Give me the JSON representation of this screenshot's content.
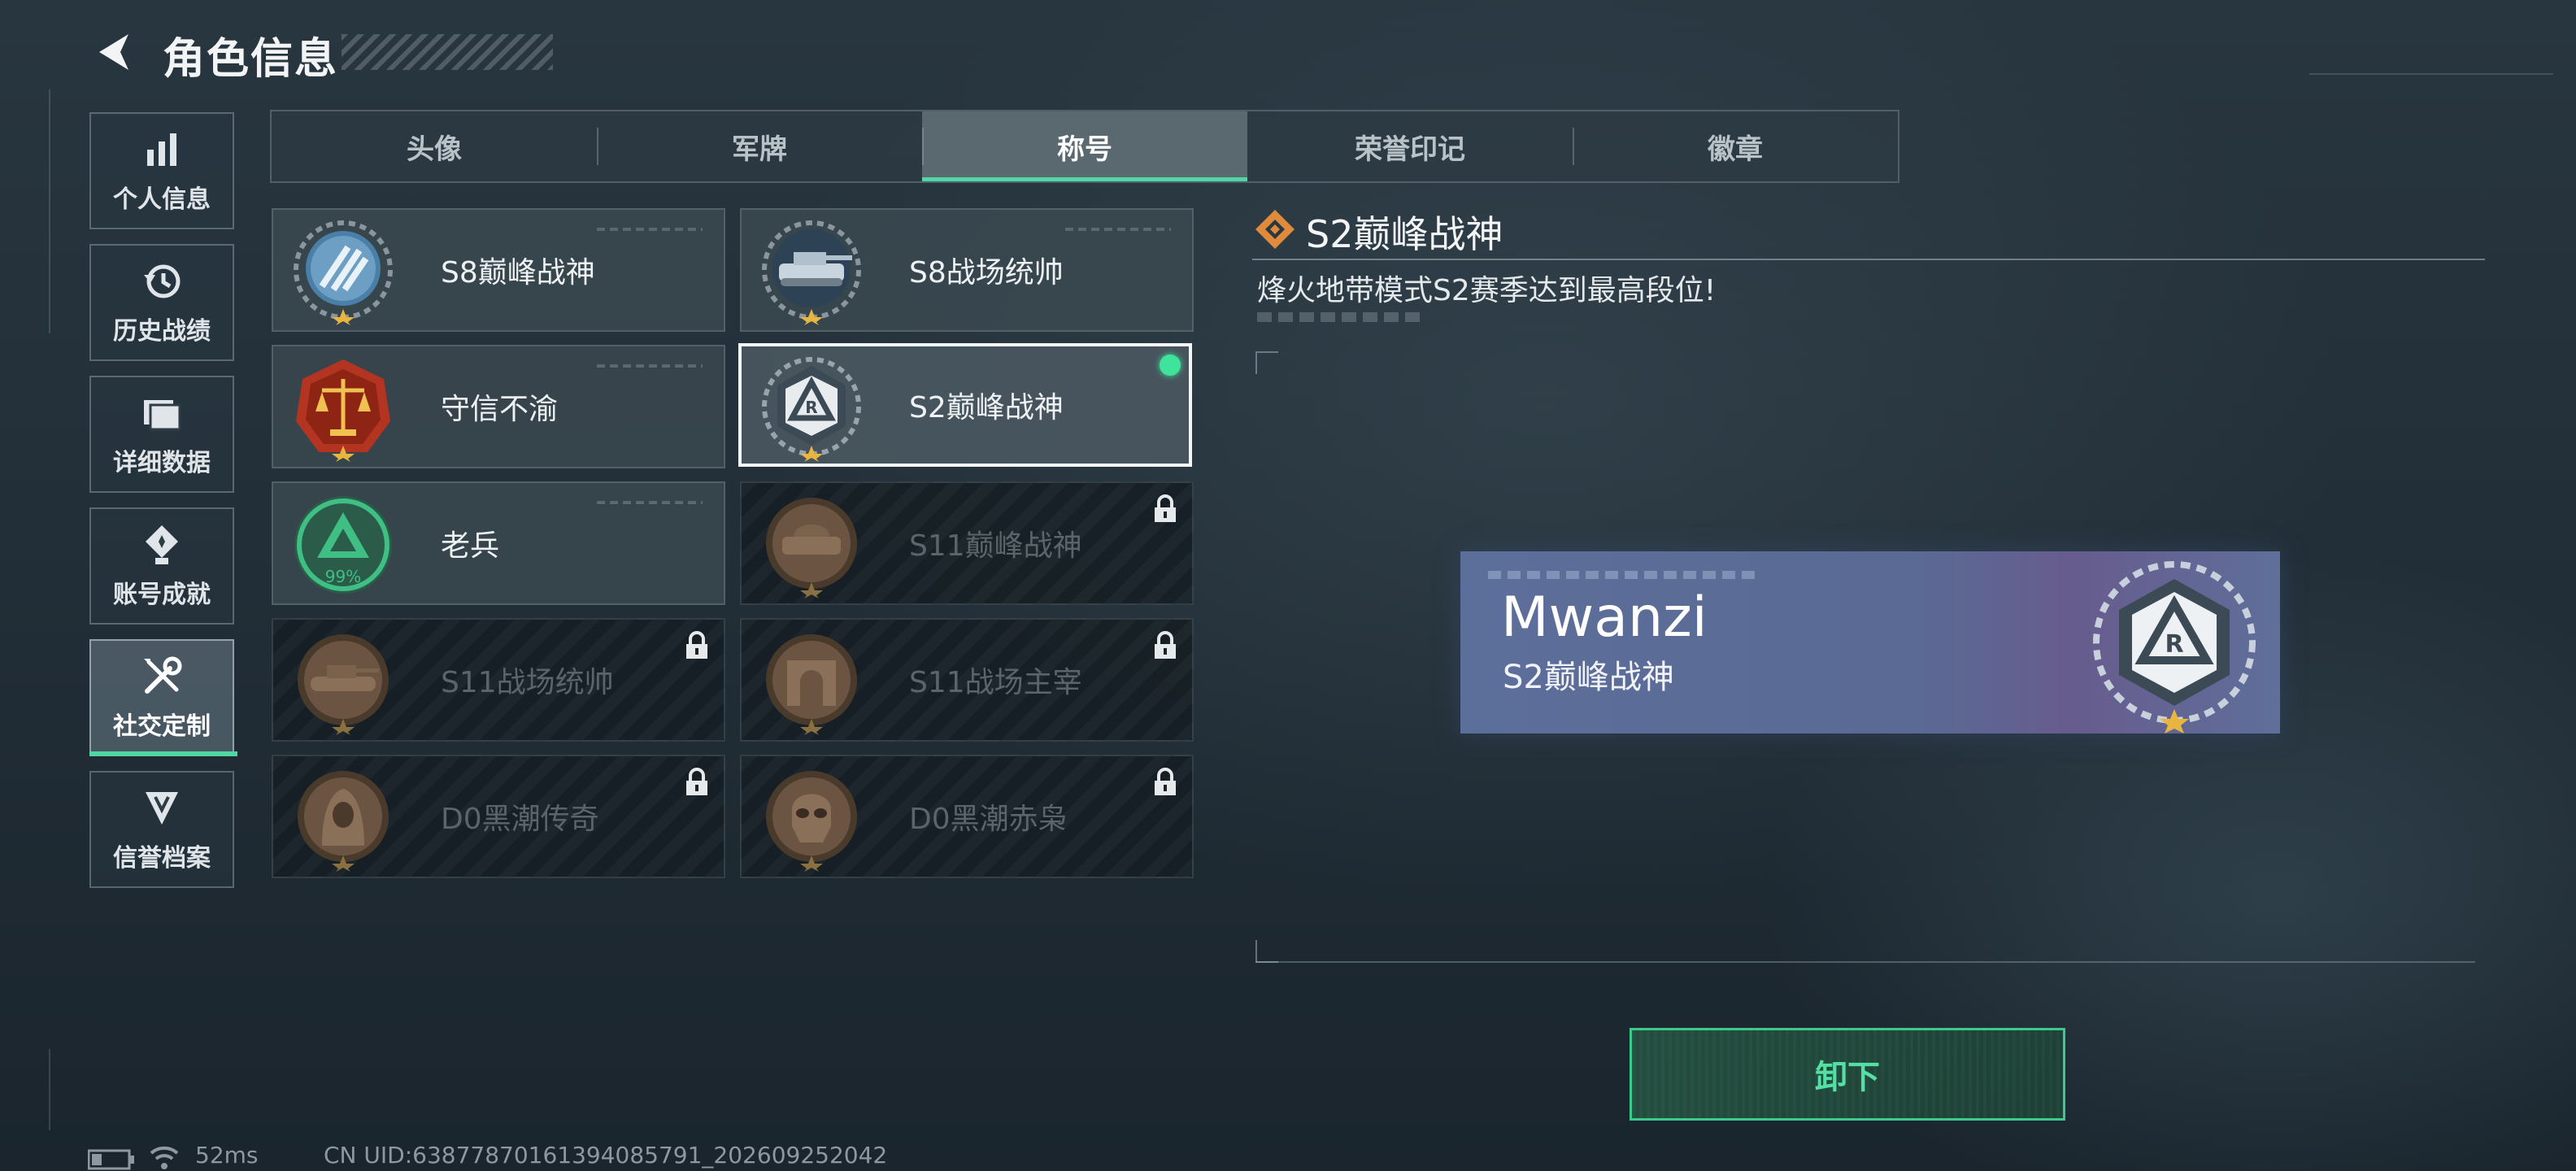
{
  "header": {
    "title": "角色信息"
  },
  "sidebar": {
    "items": [
      {
        "label": "个人信息",
        "icon": "bar-chart-icon",
        "active": false
      },
      {
        "label": "历史战绩",
        "icon": "history-clock-icon",
        "active": false
      },
      {
        "label": "详细数据",
        "icon": "folder-stack-icon",
        "active": false
      },
      {
        "label": "账号成就",
        "icon": "achievement-medal-icon",
        "active": false
      },
      {
        "label": "社交定制",
        "icon": "wrench-screwdriver-icon",
        "active": true
      },
      {
        "label": "信誉档案",
        "icon": "shield-rank-icon",
        "active": false
      }
    ]
  },
  "tabs": [
    {
      "label": "头像",
      "active": false
    },
    {
      "label": "军牌",
      "active": false
    },
    {
      "label": "称号",
      "active": true
    },
    {
      "label": "荣誉印记",
      "active": false
    },
    {
      "label": "徽章",
      "active": false
    }
  ],
  "titles": [
    {
      "name": "S8巅峰战神",
      "medal": "laurel-stripe-medal-icon",
      "locked": false,
      "selected": false
    },
    {
      "name": "S8战场统帅",
      "medal": "tank-medal-icon",
      "locked": false,
      "selected": false
    },
    {
      "name": "守信不渝",
      "medal": "scales-medal-icon",
      "locked": false,
      "selected": false
    },
    {
      "name": "S2巅峰战神",
      "medal": "r-triangle-medal-icon",
      "locked": false,
      "selected": true,
      "equipped": true
    },
    {
      "name": "老兵",
      "medal": "progress-triangle-medal-icon",
      "locked": false,
      "selected": false,
      "progress_text": "99%"
    },
    {
      "name": "S11巅峰战神",
      "medal": "bronze-vehicle-medal-icon",
      "locked": true,
      "selected": false
    },
    {
      "name": "S11战场统帅",
      "medal": "bronze-tank-medal-icon",
      "locked": true,
      "selected": false
    },
    {
      "name": "S11战场主宰",
      "medal": "bronze-arch-medal-icon",
      "locked": true,
      "selected": false
    },
    {
      "name": "D0黑潮传奇",
      "medal": "hooded-figure-medal-icon",
      "locked": true,
      "selected": false
    },
    {
      "name": "D0黑潮赤枭",
      "medal": "skull-mask-medal-icon",
      "locked": true,
      "selected": false
    }
  ],
  "detail": {
    "title": "S2巅峰战神",
    "icon": "orange-diamond-icon",
    "description": "烽火地带模式S2赛季达到最高段位!",
    "preview": {
      "player_name": "Mwanzi",
      "title": "S2巅峰战神"
    }
  },
  "action": {
    "label": "卸下"
  },
  "status": {
    "ping": "52ms",
    "uid": "CN UID:638778701613940857​91_202609252042"
  },
  "colors": {
    "accent": "#4fd6a2",
    "plate": "#5c6e9a",
    "equipped_dot": "#3fe39c",
    "detail_icon": "#e08a3c"
  }
}
